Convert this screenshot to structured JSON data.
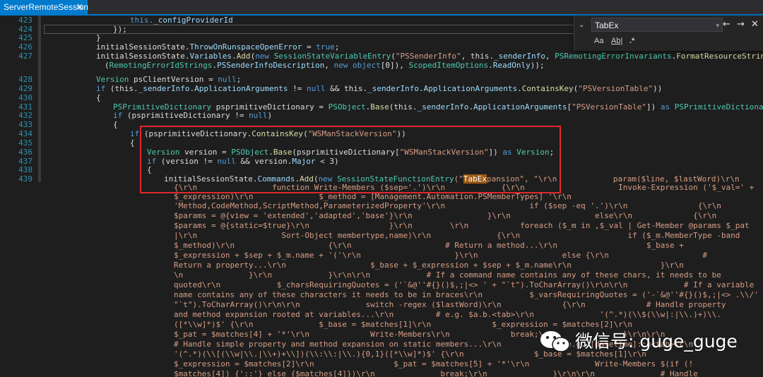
{
  "tab": {
    "title": "ServerRemoteSession",
    "close_glyph": "✕"
  },
  "line_numbers": [
    "423",
    "424",
    "425",
    "426",
    "427",
    "",
    "428",
    "429",
    "430",
    "431",
    "432",
    "433",
    "434",
    "435",
    "436",
    "437",
    "438",
    "439"
  ],
  "code": {
    "l0_a": "this.",
    "l0_b": "_configProviderId",
    "l1": "});",
    "l2": "}",
    "l3_a": "initialSessionState.",
    "l3_b": "ThrowOnRunspaceOpenError",
    "l3_c": " = ",
    "l3_d": "true",
    "l3_e": ";",
    "l4_a": "initialSessionState.",
    "l4_b": "Variables",
    "l4_c": ".",
    "l4_d": "Add",
    "l4_e": "(",
    "l4_f": "new",
    "l4_g": " ",
    "l4_h": "SessionStateVariableEntry",
    "l4_i": "(",
    "l4_j": "\"PSSenderInfo\"",
    "l4_k": ", this.",
    "l4_l": "_senderInfo",
    "l4_m": ", ",
    "l4_n": "PSRemotingErrorInvariants",
    "l4_o": ".",
    "l4_p": "FormatResourceString",
    "l5_a": "(",
    "l5_b": "RemotingErrorIdStrings",
    "l5_c": ".",
    "l5_d": "PSSenderInfoDescription",
    "l5_e": ", ",
    "l5_f": "new",
    "l5_g": " ",
    "l5_h": "object",
    "l5_i": "[0]), ",
    "l5_j": "ScopedItemOptions",
    "l5_k": ".",
    "l5_l": "ReadOnly",
    "l5_m": "));",
    "l6_a": "Version",
    "l6_b": " psClientVersion = ",
    "l6_c": "null",
    "l6_d": ";",
    "l7_a": "if",
    "l7_b": " (this.",
    "l7_c": "_senderInfo",
    "l7_d": ".",
    "l7_e": "ApplicationArguments",
    "l7_f": " != ",
    "l7_g": "null",
    "l7_h": " && this.",
    "l7_i": "_senderInfo",
    "l7_j": ".",
    "l7_k": "ApplicationArguments",
    "l7_l": ".",
    "l7_m": "ContainsKey",
    "l7_n": "(",
    "l7_o": "\"PSVersionTable\"",
    "l7_p": "))",
    "l8": "{",
    "l9_a": "PSPrimitiveDictionary",
    "l9_b": " psprimitiveDictionary = ",
    "l9_c": "PSObject",
    "l9_d": ".",
    "l9_e": "Base",
    "l9_f": "(this.",
    "l9_g": "_senderInfo",
    "l9_h": ".",
    "l9_i": "ApplicationArguments",
    "l9_j": "[",
    "l9_k": "\"PSVersionTable\"",
    "l9_l": "]) ",
    "l9_m": "as",
    "l9_n": " ",
    "l9_o": "PSPrimitiveDictionary",
    "l9_p": ";",
    "l10_a": "if",
    "l10_b": " (psprimitiveDictionary != ",
    "l10_c": "null",
    "l10_d": ")",
    "l11": "{",
    "l12_a": "if",
    "l12_b": " (psprimitiveDictionary.",
    "l12_c": "ContainsKey",
    "l12_d": "(",
    "l12_e": "\"WSManStackVersion\"",
    "l12_f": "))",
    "l13": "{",
    "l14_a": "Version",
    "l14_b": " version = ",
    "l14_c": "PSObject",
    "l14_d": ".",
    "l14_e": "Base",
    "l14_f": "(psprimitiveDictionary[",
    "l14_g": "\"WSManStackVersion\"",
    "l14_h": "]) ",
    "l14_i": "as",
    "l14_j": " ",
    "l14_k": "Version",
    "l14_l": ";",
    "l15_a": "if",
    "l15_b": " (version != ",
    "l15_c": "null",
    "l15_d": " && version.",
    "l15_e": "Major",
    "l15_f": " < 3)",
    "l16": "{",
    "l17_a": "initialSessionState.",
    "l17_b": "Commands",
    "l17_c": ".",
    "l17_d": "Add",
    "l17_e": "(",
    "l17_f": "new",
    "l17_g": " ",
    "l17_h": "SessionStateFunctionEntry",
    "l17_i": "(\"",
    "l17_j": "TabEx",
    "l17_k": "pansion\", \"\\r\\n            param($line, $lastWord)\\r\\n           &",
    "s1": "{\\r\\n                function Write-Members ($sep='.')\\r\\n            {\\r\\n                    Invoke-Expression ('$_val=' +",
    "s2": "$_expression)\\r\\n              $_method = [Management.Automation.PSMemberTypes] '\\r\\n",
    "s3": "'Method,CodeMethod,ScriptMethod,ParameterizedProperty'\\r\\n                  if ($sep -eq '.')\\r\\n               {\\r\\n",
    "s4": "$params = @{view = 'extended','adapted','base'}\\r\\n                }\\r\\n                  else\\r\\n             {\\r\\n",
    "s5": "$params = @{static=$true}\\r\\n                 }\\r\\n        \\r\\n           foreach ($_m in ,$_val | Get-Member @params $_pat",
    "s6": "|\\r\\n                  Sort-Object membertype,name)\\r\\n              {\\r\\n                       if ($_m.MemberType -band",
    "s7": "$_method)\\r\\n                    {\\r\\n                    # Return a method...\\r\\n                   $_base +",
    "s8": "$_expression + $sep + $_m.name + '('\\r\\n                    }\\r\\n                  else {\\r\\n                    #",
    "s9": "Return a property...\\r\\n                  $_base + $_expression + $sep + $_m.name\\r\\n                   }\\r\\n",
    "s10": "\\n              }\\r\\n            }\\r\\n\\r\\n            # If a command name contains any of these chars, it needs to be",
    "s11": "quoted\\r\\n            $_charsRequiringQuotes = ('`&@''#{}()$,;|<> ' + \"`t\").ToCharArray()\\r\\n\\r\\n            # If a variable",
    "s12": "name contains any of these characters it needs to be in braces\\r\\n          $_varsRequiringQuotes = ('-`&@''#{}()$,;|<> .\\\\/' +",
    "s13": "\"`t\").ToCharArray()\\r\\n\\r\\n              switch -regex ($lastWord)\\r\\n             {\\r\\n             # Handle property",
    "s14": "and method expansion rooted at variables...\\r\\n         # e.g. $a.b.<tab>\\r\\n              '(^.*)(\\\\$(\\\\w|:|\\\\.)+)\\\\.",
    "s15": "([*\\\\w]*)$' {\\r\\n              $_base = $matches[1]\\r\\n             $_expression = $matches[2]\\r\\n",
    "s16": "$_pat = $matches[4] + '*'\\r\\n             Write-Members\\r\\n             break;\\r\\n              }\\r\\n\\r\\n",
    "s17": "# Handle simple property and method expansion on static members...\\r\\n            # e.g. [datetime]::n<tab>\\r\\n",
    "s18": "'(^.*)(\\\\[(\\\\w|\\\\.|\\\\+)+\\\\])(\\\\:\\\\:|\\\\.){0,1}([*\\\\w]*)$' {\\r\\n               $_base = $matches[1]\\r\\n",
    "s19": "$_expression = $matches[2]\\r\\n                 $_pat = $matches[5] + '*'\\r\\n              Write-Members $(if (!",
    "s20": "$matches[4]) {'::'} else {$matches[4]})\\r\\n              break;\\r\\n              }\\r\\n\\r\\n              # Handle"
  },
  "find": {
    "toggle_glyph": "⌄",
    "query": "TabEx",
    "dropdown_glyph": "▾",
    "prev_glyph": "←",
    "next_glyph": "→",
    "close_glyph": "✕",
    "match_case": "Aa",
    "whole_word": "Ab|",
    "regex": ".*"
  },
  "watermark": {
    "text": "微信号: guge_guge"
  },
  "colors": {
    "accent": "#007acc",
    "highlight": "#e0282e",
    "match": "#9e5a12"
  }
}
